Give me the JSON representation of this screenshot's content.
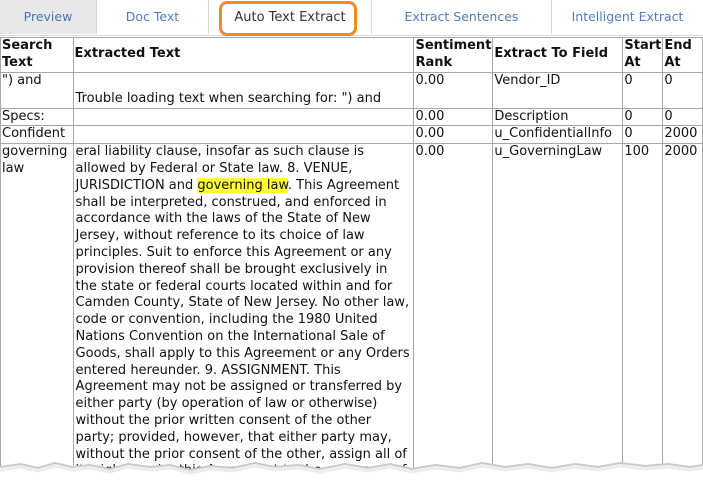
{
  "tabs": [
    {
      "label": "Preview"
    },
    {
      "label": "Doc Text"
    },
    {
      "label": "Auto Text Extract"
    },
    {
      "label": "Extract Sentences"
    },
    {
      "label": "Intelligent Extract"
    }
  ],
  "table": {
    "headers": {
      "search_text": "Search Text",
      "extracted_text": "Extracted Text",
      "sentiment_rank": "Sentiment Rank",
      "extract_to_field": "Extract To Field",
      "start_at": "Start At",
      "end_at": "End At"
    },
    "rows": [
      {
        "search_text": "\") and",
        "extracted_text": "Trouble loading text when searching for: \") and",
        "sentiment_rank": "0.00",
        "extract_to_field": "Vendor_ID",
        "start_at": "0",
        "end_at": "0"
      },
      {
        "search_text": "Specs:",
        "extracted_text": "",
        "sentiment_rank": "0.00",
        "extract_to_field": "Description",
        "start_at": "0",
        "end_at": "0"
      },
      {
        "search_text": "Confident",
        "extracted_text": "",
        "sentiment_rank": "0.00",
        "extract_to_field": "u_ConfidentialInfo",
        "start_at": "0",
        "end_at": "2000"
      },
      {
        "search_text": "governing law",
        "extracted_before": "eral liability clause, insofar as such clause is allowed by Federal or State law. 8. VENUE, JURISDICTION and ",
        "extracted_highlight": "governing law",
        "extracted_after": ". This Agreement shall be interpreted, construed, and enforced in accordance with the laws of the State of New Jersey, without reference to its choice of law principles. Suit to enforce this Agreement or any provision thereof shall be brought exclusively in the state or federal courts located within and for Camden County, State of New Jersey. No other law, code or convention, including the 1980 United Nations Convention on the International Sale of Goods, shall apply to this Agreement or any Orders entered hereunder. 9. ASSIGNMENT. This Agreement may not be assigned or transferred by either party (by operation of law or otherwise) without the prior written consent of the other party; provided, however, that either party may, without the prior consent of the other, assign all of its rights under this Agreement to the successor of all or substantially",
        "sentiment_rank": "0.00",
        "extract_to_field": "u_GoverningLaw",
        "start_at": "100",
        "end_at": "2000"
      }
    ]
  },
  "colors": {
    "tab_link": "#4f7bbf",
    "highlight_ring": "#f08a24",
    "text_highlight": "#ffff33",
    "grid_border": "#a8a8a8"
  }
}
